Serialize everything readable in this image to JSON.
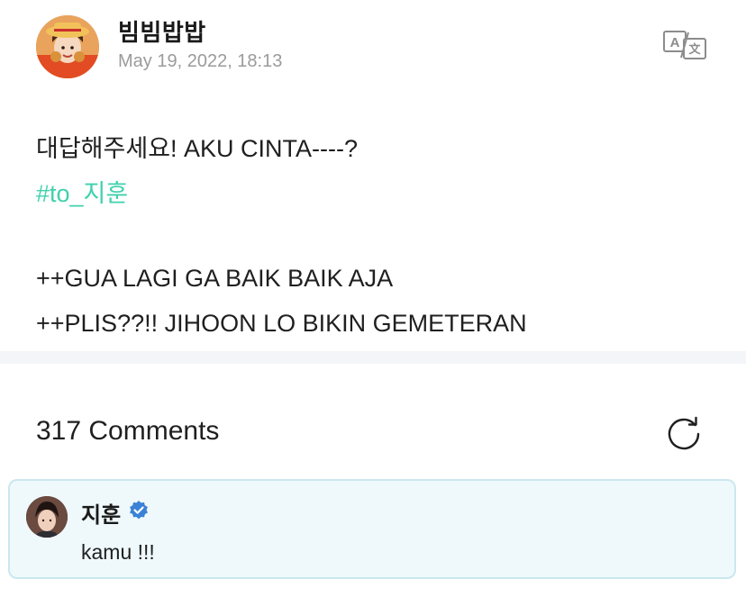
{
  "post": {
    "author": "빔빔밥밥",
    "date": "May 19, 2022, 18:13",
    "translate_icon": "translate-icon",
    "lines": [
      "대답해주세요! AKU CINTA----?",
      "#to_지훈",
      "++GUA LAGI GA BAIK BAIK AJA",
      "++PLIS??!! JIHOON LO BIKIN GEMETERAN"
    ]
  },
  "comments": {
    "title": "317 Comments",
    "refresh_icon": "refresh-icon",
    "items": [
      {
        "author": "지훈",
        "verified_icon": "verified-badge-icon",
        "text": "kamu !!!"
      }
    ]
  },
  "colors": {
    "hashtag": "#3fd1ad",
    "date": "#9b9b9b",
    "comment_bg": "#eff9fc",
    "comment_border": "#cbe7ef",
    "verified": "#3b82d6",
    "divider": "#f4f5f8"
  }
}
